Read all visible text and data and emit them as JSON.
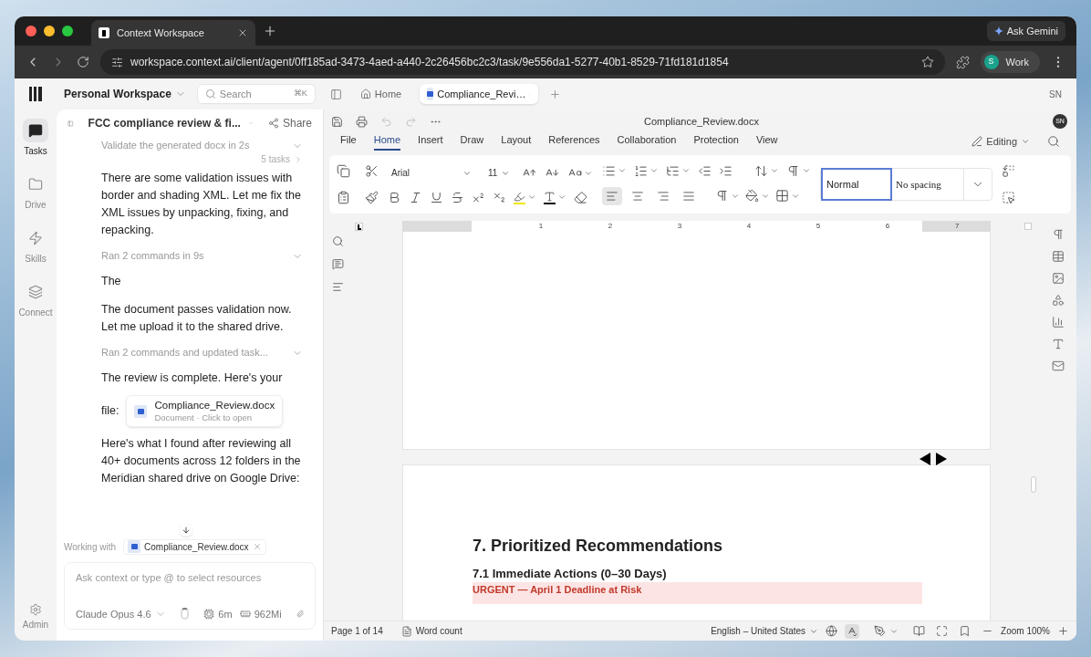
{
  "browser": {
    "tabs": [
      {
        "title": "Context Workspace",
        "selected": true
      }
    ],
    "ask_gemini": "Ask Gemini",
    "url": "workspace.context.ai/client/agent/0ff185ad-3473-4aed-a440-2c26456bc2c3/task/9e556da1-5277-40b1-8529-71fd181d1854",
    "profile": {
      "initial": "S",
      "label": "Work"
    }
  },
  "app_header": {
    "workspace": "Personal Workspace",
    "search": {
      "placeholder": "Search",
      "shortcut": "⌘K"
    },
    "tabs": [
      {
        "label": "Home",
        "kind": "home",
        "selected": false
      },
      {
        "label": "Compliance_Revi…",
        "kind": "doc",
        "selected": true
      }
    ],
    "user_initials": "SN"
  },
  "rail": [
    {
      "label": "Tasks",
      "kind": "tasks",
      "selected": true
    },
    {
      "label": "Drive",
      "kind": "drive",
      "selected": false
    },
    {
      "label": "Skills",
      "kind": "skills",
      "selected": false
    },
    {
      "label": "Connect",
      "kind": "connect",
      "selected": false
    }
  ],
  "rail_bottom": {
    "label": "Admin"
  },
  "chat": {
    "title": "FCC compliance review & fi...",
    "share": "Share",
    "tasks_badge": "5 tasks",
    "messages": [
      {
        "kind": "step",
        "text": "Validate the generated docx in 2s"
      },
      {
        "kind": "text",
        "text": "There are some validation issues with border and shading XML. Let me fix the XML issues by unpacking, fixing, and repacking."
      },
      {
        "kind": "step",
        "text": "Ran 2 commands in 9s"
      },
      {
        "kind": "text",
        "text": "The"
      },
      {
        "kind": "text",
        "text": "The document passes validation now. Let me upload it to the shared drive."
      },
      {
        "kind": "step",
        "text": "Ran 2 commands and updated task..."
      },
      {
        "kind": "text",
        "text": "The review is complete. Here's your"
      },
      {
        "kind": "file",
        "lead": "file:",
        "name": "Compliance_Review.docx",
        "meta": "Document · Click to open"
      },
      {
        "kind": "text",
        "text": "Here's what I found after reviewing all 40+ documents across 12 folders in the Meridian shared drive on Google Drive:"
      }
    ],
    "working_with": {
      "label": "Working with",
      "file": "Compliance_Review.docx"
    },
    "composer": {
      "placeholder": "Ask context or type @ to select resources",
      "model": "Claude Opus 4.6",
      "time": "6m",
      "memory": "962Mi"
    }
  },
  "doc": {
    "filename": "Compliance_Review.docx",
    "user_initials": "SN",
    "menu": [
      {
        "label": "File",
        "selected": false
      },
      {
        "label": "Home",
        "selected": true
      },
      {
        "label": "Insert",
        "selected": false
      },
      {
        "label": "Draw",
        "selected": false
      },
      {
        "label": "Layout",
        "selected": false
      },
      {
        "label": "References",
        "selected": false
      },
      {
        "label": "Collaboration",
        "selected": false
      },
      {
        "label": "Protection",
        "selected": false
      },
      {
        "label": "View",
        "selected": false
      }
    ],
    "mode": "Editing",
    "font": "Arial",
    "size": "11",
    "align": [
      {
        "kind": "left",
        "selected": true
      },
      {
        "kind": "center",
        "selected": false
      },
      {
        "kind": "right",
        "selected": false
      },
      {
        "kind": "justify",
        "selected": false
      }
    ],
    "styles": [
      {
        "label": "Normal",
        "kind": "sans",
        "selected": true
      },
      {
        "label": "No spacing",
        "kind": "serif",
        "selected": false
      }
    ],
    "ruler": [
      "1",
      "2",
      "3",
      "4",
      "5",
      "6",
      "7"
    ],
    "content": {
      "heading": "7. Prioritized Recommendations",
      "subheading": "7.1 Immediate Actions (0–30 Days)",
      "alert": "URGENT — April 1 Deadline at Risk"
    }
  },
  "status_bar": {
    "page": "Page 1 of 14",
    "word_count": "Word count",
    "language": "English – United States",
    "zoom": "Zoom 100%"
  }
}
